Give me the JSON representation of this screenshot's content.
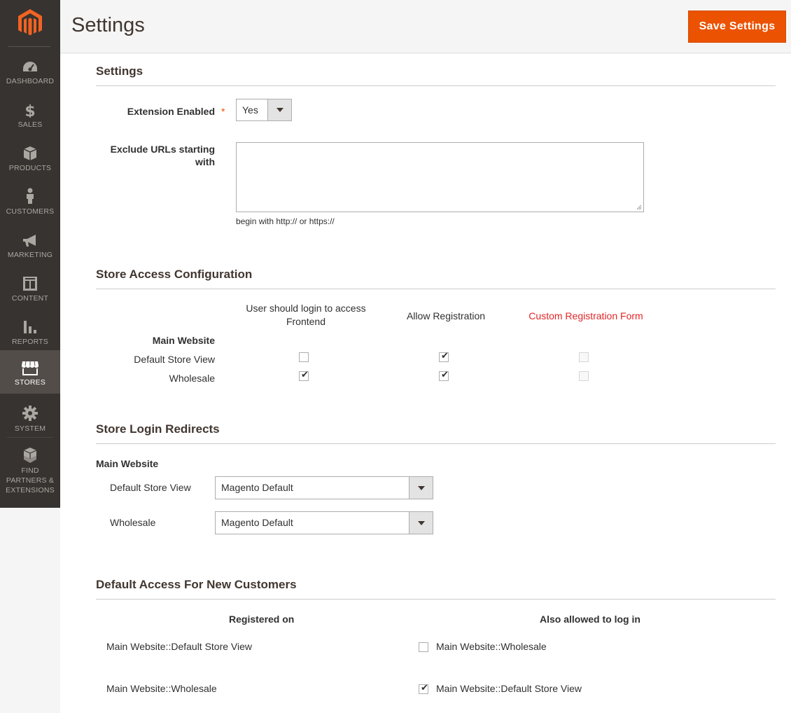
{
  "sidebar": {
    "logo": "magento-logo",
    "items": [
      {
        "label": "DASHBOARD",
        "icon": "dashboard-icon"
      },
      {
        "label": "SALES",
        "icon": "dollar-icon"
      },
      {
        "label": "PRODUCTS",
        "icon": "box-icon"
      },
      {
        "label": "CUSTOMERS",
        "icon": "person-icon"
      },
      {
        "label": "MARKETING",
        "icon": "megaphone-icon"
      },
      {
        "label": "CONTENT",
        "icon": "layout-icon"
      },
      {
        "label": "REPORTS",
        "icon": "bar-chart-icon"
      },
      {
        "label": "STORES",
        "icon": "storefront-icon",
        "active": true
      },
      {
        "label": "SYSTEM",
        "icon": "gear-icon"
      },
      {
        "label": "FIND PARTNERS & EXTENSIONS",
        "icon": "blocks-icon"
      }
    ]
  },
  "header": {
    "title": "Settings",
    "save_label": "Save Settings"
  },
  "settings": {
    "title": "Settings",
    "extension_enabled_label": "Extension Enabled",
    "required_mark": "*",
    "extension_enabled_value": "Yes",
    "exclude_urls_label": "Exclude URLs starting with",
    "exclude_urls_value": "",
    "exclude_urls_hint": "begin with http:// or https://"
  },
  "store_access": {
    "title": "Store Access Configuration",
    "columns": [
      "User should login to access Frontend",
      "Allow Registration",
      "Custom Registration Form"
    ],
    "website_label": "Main Website",
    "rows": [
      {
        "label": "Default Store View",
        "login_required": false,
        "allow_registration": true,
        "custom_form": false
      },
      {
        "label": "Wholesale",
        "login_required": true,
        "allow_registration": true,
        "custom_form": false
      }
    ]
  },
  "login_redirects": {
    "title": "Store Login Redirects",
    "website_label": "Main Website",
    "rows": [
      {
        "label": "Default Store View",
        "value": "Magento Default"
      },
      {
        "label": "Wholesale",
        "value": "Magento Default"
      }
    ]
  },
  "default_access": {
    "title": "Default Access For New Customers",
    "col_registered": "Registered on",
    "col_allowed": "Also allowed to log in",
    "rows": [
      {
        "registered": "Main Website::Default Store View",
        "allowed": "Main Website::Wholesale",
        "checked": false
      },
      {
        "registered": "Main Website::Wholesale",
        "allowed": "Main Website::Default Store View",
        "checked": true
      }
    ]
  },
  "colors": {
    "accent": "#eb5202",
    "sidebar_bg": "#373330",
    "sidebar_active": "#524d49",
    "custom_form_label": "#e22626"
  }
}
